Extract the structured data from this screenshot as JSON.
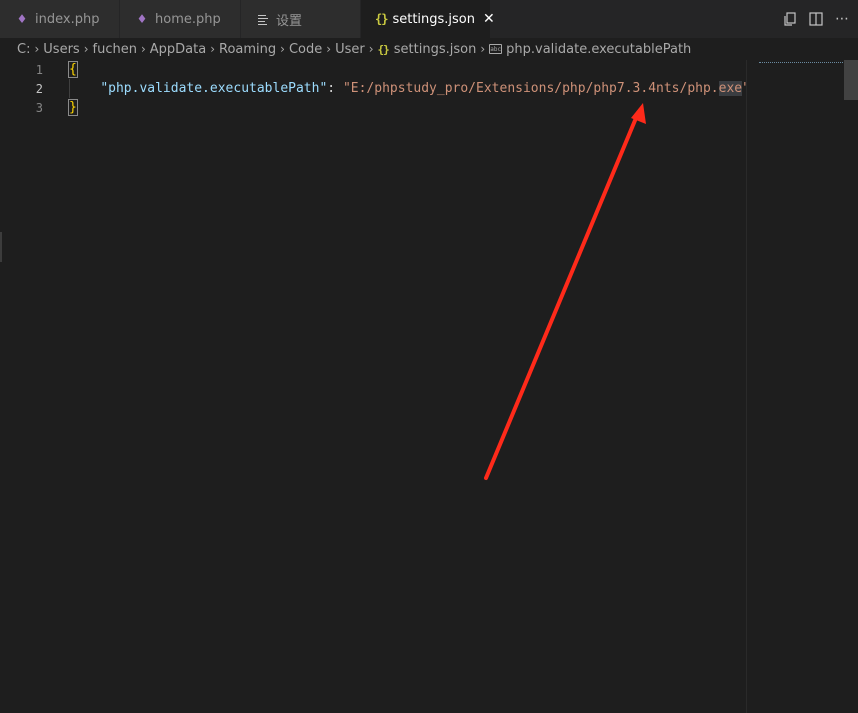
{
  "tabs": [
    {
      "label": "index.php",
      "icon": "php-elephant-icon"
    },
    {
      "label": "home.php",
      "icon": "php-elephant-icon"
    },
    {
      "label": "设置",
      "icon": "settings-list-icon"
    },
    {
      "label": "settings.json",
      "icon": "json-braces-icon",
      "active": true
    }
  ],
  "breadcrumb": {
    "items": [
      "C:",
      "Users",
      "fuchen",
      "AppData",
      "Roaming",
      "Code",
      "User"
    ],
    "file": "settings.json",
    "symbol": "php.validate.executablePath",
    "symbol_icon_text": "abc"
  },
  "editor": {
    "lines": [
      {
        "no": "1",
        "open": "{"
      },
      {
        "no": "2",
        "indent": "    ",
        "key": "\"php.validate.executablePath\"",
        "colon": ": ",
        "value_main": "\"E:/phpstudy_pro/Extensions/php/php7.3.4nts/php.",
        "value_selected": "exe",
        "value_end": "\""
      },
      {
        "no": "3",
        "close": "}"
      }
    ]
  },
  "colors": {
    "annotation_arrow": "#ff2a1a",
    "string": "#ce9178",
    "key": "#9cdcfe",
    "brace": "#ffd700"
  }
}
